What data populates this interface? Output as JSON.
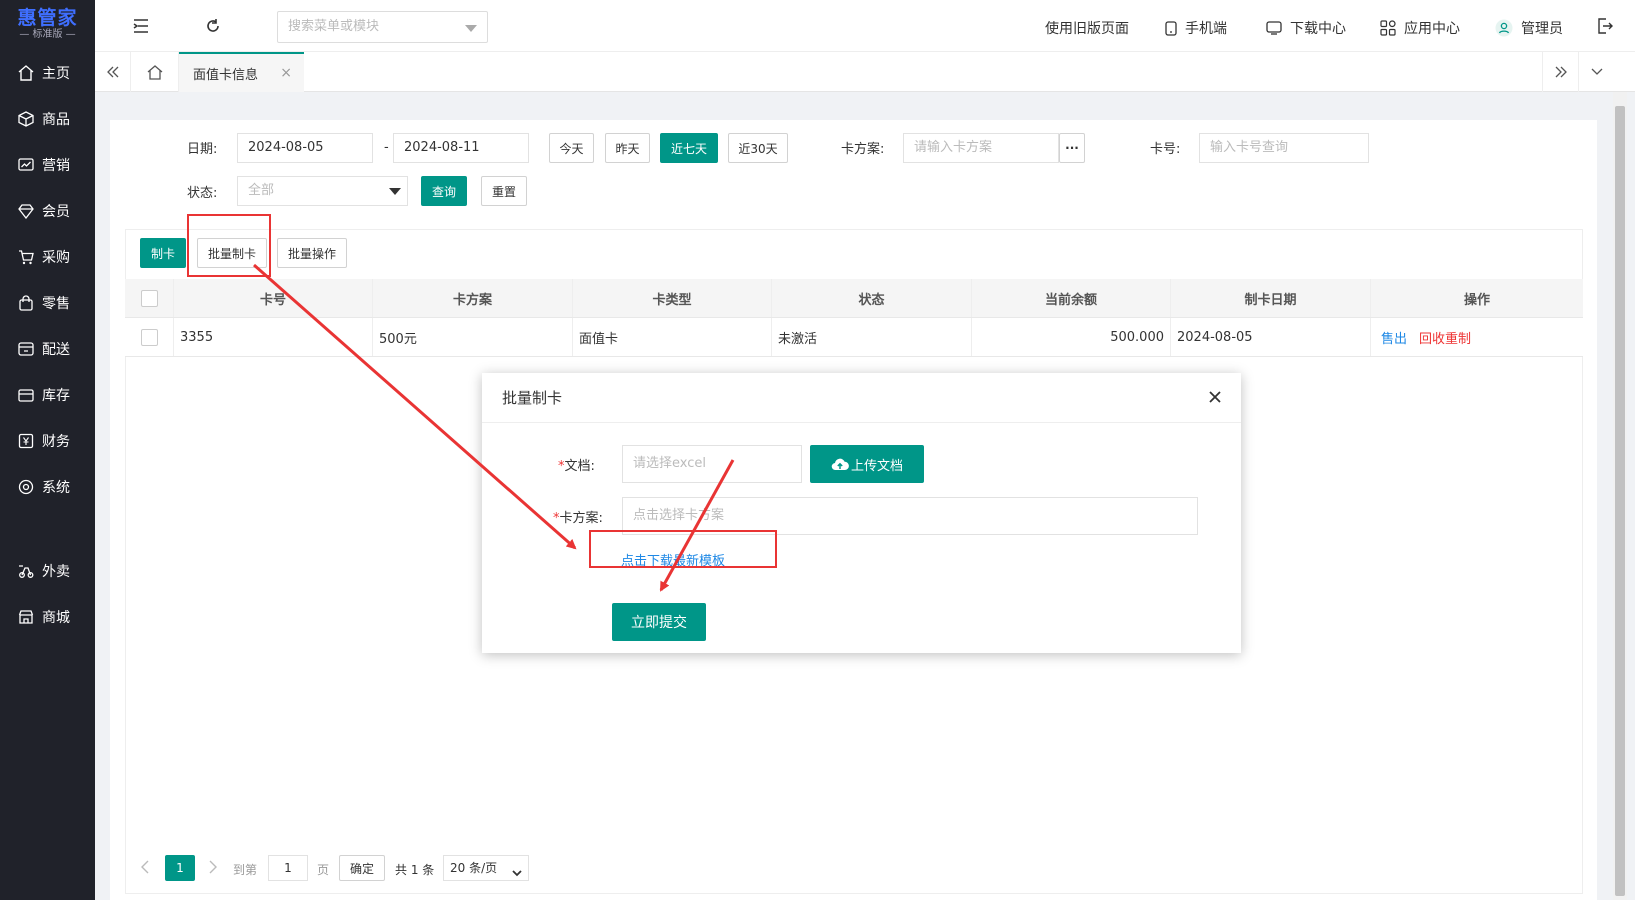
{
  "app": {
    "logo_main": "惠管家",
    "logo_sub": "— 标准版 —"
  },
  "sidebar": {
    "items": [
      {
        "label": "主页",
        "icon": "home-icon"
      },
      {
        "label": "商品",
        "icon": "box-icon"
      },
      {
        "label": "营销",
        "icon": "chart-icon"
      },
      {
        "label": "会员",
        "icon": "diamond-icon"
      },
      {
        "label": "采购",
        "icon": "cart-icon"
      },
      {
        "label": "零售",
        "icon": "bag-icon"
      },
      {
        "label": "配送",
        "icon": "delivery-icon"
      },
      {
        "label": "库存",
        "icon": "storage-icon"
      },
      {
        "label": "财务",
        "icon": "finance-icon"
      },
      {
        "label": "系统",
        "icon": "target-icon"
      },
      {
        "label": "外卖",
        "icon": "takeout-icon"
      },
      {
        "label": "商城",
        "icon": "store-icon"
      }
    ]
  },
  "topbar": {
    "search_placeholder": "搜索菜单或模块",
    "links": {
      "old_page": "使用旧版页面",
      "mobile": "手机端",
      "download": "下载中心",
      "apps": "应用中心",
      "user": "管理员"
    }
  },
  "tabs": {
    "active_label": "面值卡信息",
    "close": "×"
  },
  "filters": {
    "date_label": "日期:",
    "date_start": "2024-08-05",
    "date_sep": "-",
    "date_end": "2024-08-11",
    "quick": {
      "today": "今天",
      "yesterday": "昨天",
      "last7": "近七天",
      "last30": "近30天"
    },
    "plan_label": "卡方案:",
    "plan_placeholder": "请输入卡方案",
    "plan_more": "···",
    "cardno_label": "卡号:",
    "cardno_placeholder": "输入卡号查询",
    "status_label": "状态:",
    "status_value": "全部",
    "query": "查询",
    "reset": "重置"
  },
  "toolbar": {
    "make": "制卡",
    "batch_make": "批量制卡",
    "batch_ops": "批量操作"
  },
  "table": {
    "headers": [
      "卡号",
      "卡方案",
      "卡类型",
      "状态",
      "当前余额",
      "制卡日期",
      "操作"
    ],
    "rows": [
      {
        "card_no": "3355",
        "plan": "500元",
        "type": "面值卡",
        "status": "未激活",
        "balance": "500.000",
        "date": "2024-08-05",
        "sell": "售出",
        "recycle": "回收重制"
      }
    ]
  },
  "pager": {
    "page": "1",
    "goto": "到第",
    "page_input": "1",
    "page_unit": "页",
    "confirm": "确定",
    "total": "共 1 条",
    "per_page": "20 条/页"
  },
  "dialog": {
    "title": "批量制卡",
    "doc_label": "文档:",
    "doc_placeholder": "请选择excel",
    "upload": "上传文档",
    "plan_label": "卡方案:",
    "plan_placeholder": "点击选择卡方案",
    "download_link": "点击下载最新模板",
    "submit": "立即提交",
    "required_mark": "*"
  },
  "colors": {
    "primary": "#009688",
    "sidebar": "#20222a",
    "danger": "#e93434",
    "link": "#1e88e5",
    "accent_red": "#e33"
  }
}
